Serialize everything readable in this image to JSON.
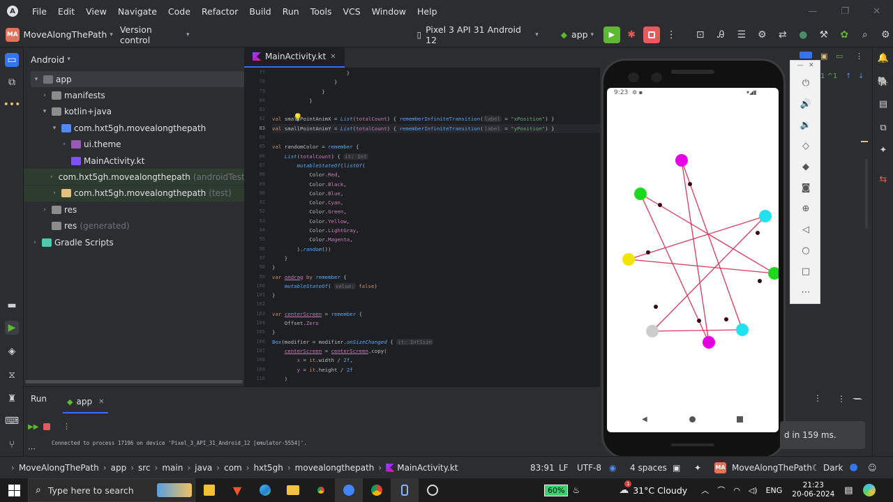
{
  "menu": {
    "items": [
      "File",
      "Edit",
      "View",
      "Navigate",
      "Code",
      "Refactor",
      "Build",
      "Run",
      "Tools",
      "VCS",
      "Window",
      "Help"
    ],
    "window_controls": [
      "—",
      "❐",
      "✕"
    ]
  },
  "toolbar": {
    "project_badge": "MA",
    "project_name": "MoveAlongThePath",
    "version_control": "Version control",
    "device": "Pixel 3 API 31 Android 12",
    "run_config": "app"
  },
  "project_panel": {
    "view": "Android",
    "tree": [
      {
        "label": "app",
        "sub": "",
        "depth": 0,
        "arrow": "▾",
        "color": "#6f737a"
      },
      {
        "label": "manifests",
        "sub": "",
        "depth": 1,
        "arrow": "›",
        "color": "#8c8c8c"
      },
      {
        "label": "kotlin+java",
        "sub": "",
        "depth": 1,
        "arrow": "▾",
        "color": "#8c8c8c"
      },
      {
        "label": "com.hxt5gh.movealongthepath",
        "sub": "",
        "depth": 2,
        "arrow": "▾",
        "color": "#548af7"
      },
      {
        "label": "ui.theme",
        "sub": "",
        "depth": 3,
        "arrow": "›",
        "color": "#9b59b6"
      },
      {
        "label": "MainActivity.kt",
        "sub": "",
        "depth": 3,
        "arrow": "",
        "color": "#7f52ff"
      },
      {
        "label": "com.hxt5gh.movealongthepath",
        "sub": "(androidTest)",
        "depth": 2,
        "arrow": "›",
        "color": "#e5c07b"
      },
      {
        "label": "com.hxt5gh.movealongthepath",
        "sub": "(test)",
        "depth": 2,
        "arrow": "›",
        "color": "#e5c07b"
      },
      {
        "label": "res",
        "sub": "",
        "depth": 1,
        "arrow": "›",
        "color": "#8c8c8c"
      },
      {
        "label": "res",
        "sub": "(generated)",
        "depth": 1,
        "arrow": "",
        "color": "#8c8c8c"
      },
      {
        "label": "Gradle Scripts",
        "sub": "",
        "depth": 0,
        "arrow": "›",
        "color": "#4ec9b0"
      }
    ]
  },
  "editor": {
    "tab_label": "MainActivity.kt",
    "line_numbers": [
      "77",
      "78",
      "79",
      "80",
      "81",
      "82",
      "83",
      "84",
      "85",
      "86",
      "87",
      "88",
      "89",
      "90",
      "91",
      "92",
      "93",
      "94",
      "95",
      "96",
      "97",
      "98",
      "99",
      "100",
      "101",
      "102",
      "103",
      "104",
      "105",
      "106",
      "107",
      "108",
      "109",
      "110"
    ],
    "inspection": "1  ^1"
  },
  "emulator": {
    "time": "9:23"
  },
  "run_panel": {
    "run_tab": "Run",
    "app_tab": "app",
    "output": "Connected to process 17196 on device 'Pixel_3_API_31_Android_12 [emulator-5554]'."
  },
  "toast": "d in 159 ms.",
  "status": {
    "breadcrumb": [
      "MoveAlongThePath",
      "app",
      "src",
      "main",
      "java",
      "com",
      "hxt5gh",
      "movealongthepath",
      "MainActivity.kt"
    ],
    "position": "83:91",
    "line_sep": "LF",
    "encoding": "UTF-8",
    "indent": "4 spaces",
    "project_badge": "MA",
    "project": "MoveAlongThePath",
    "theme": "Dark"
  },
  "taskbar": {
    "search_placeholder": "Type here to search",
    "battery": "60%",
    "weather": "31°C  Cloudy",
    "lang": "ENG",
    "time": "21:23",
    "date": "20-06-2024",
    "notif_count": "1"
  },
  "colors": {
    "accent": "#3574f0",
    "bg": "#2b2d30",
    "editor_bg": "#1e1f22",
    "run_green": "#5fb832",
    "stop_red": "#e55b5b",
    "line": "#d63a5b"
  }
}
